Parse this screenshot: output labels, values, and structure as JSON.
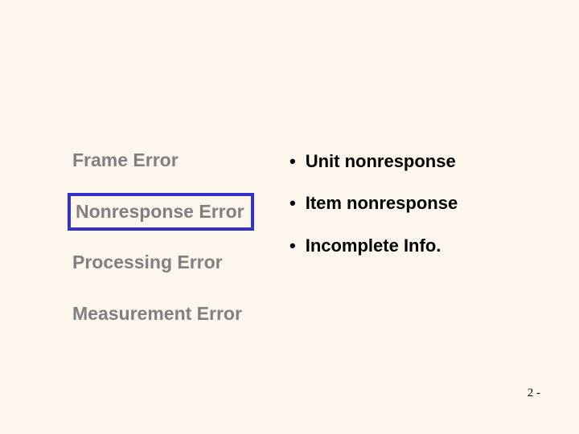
{
  "left": {
    "items": [
      {
        "label": "Frame Error",
        "highlighted": false
      },
      {
        "label": "Nonresponse Error",
        "highlighted": true
      },
      {
        "label": "Processing Error",
        "highlighted": false
      },
      {
        "label": "Measurement Error",
        "highlighted": false
      }
    ]
  },
  "right": {
    "items": [
      "Unit nonresponse",
      "Item nonresponse",
      "Incomplete Info."
    ]
  },
  "page_number": "2 -"
}
